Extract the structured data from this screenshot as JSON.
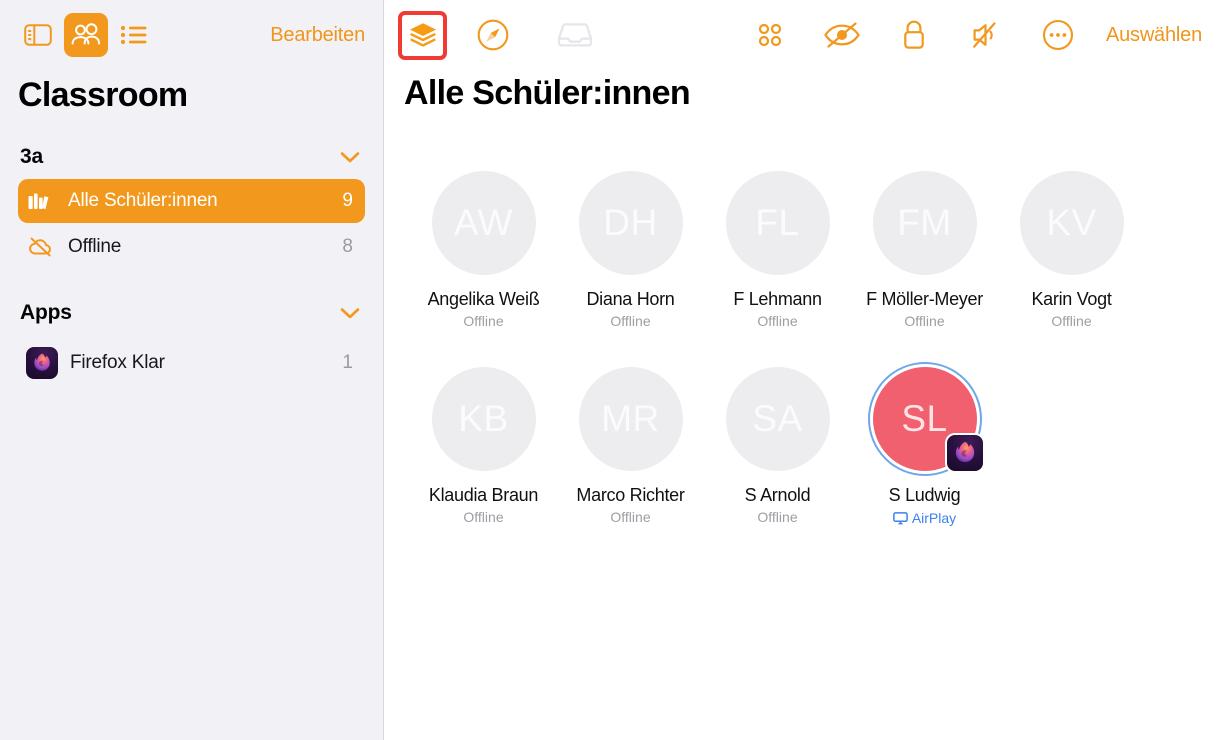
{
  "colors": {
    "accent": "#F2981D",
    "accent_text": "#F0961C",
    "sidebar_bg": "#F2F1F6",
    "highlight_red": "#F03B34",
    "online_avatar": "#F0606E",
    "online_ring": "#6FA8E8",
    "airplay_blue": "#3B82F0",
    "offline_avatar": "#EDEDEF",
    "muted_text": "#9D9DA3"
  },
  "sidebar": {
    "toolbar": {
      "sidebar_toggle_icon": "sidebar-toggle-icon",
      "people_icon": "people-icon",
      "list_icon": "list-icon",
      "edit_label": "Bearbeiten"
    },
    "title": "Classroom",
    "sections": [
      {
        "title": "3a",
        "chevron": "chevron-down-icon",
        "rows": [
          {
            "icon": "books-icon",
            "label": "Alle Schüler:innen",
            "count": "9",
            "selected": true
          },
          {
            "icon": "cloud-slash-icon",
            "label": "Offline",
            "count": "8",
            "selected": false
          }
        ]
      },
      {
        "title": "Apps",
        "chevron": "chevron-down-icon",
        "apps": [
          {
            "icon": "firefox-klar-icon",
            "label": "Firefox Klar",
            "count": "1"
          }
        ]
      }
    ]
  },
  "main": {
    "toolbar": {
      "left": [
        {
          "name": "layers-icon",
          "label": "Layers",
          "highlighted": true,
          "enabled": true
        },
        {
          "name": "compass-icon",
          "label": "Navigate",
          "highlighted": false,
          "enabled": true
        },
        {
          "name": "tray-icon",
          "label": "Inbox",
          "highlighted": false,
          "enabled": false
        }
      ],
      "right": [
        {
          "name": "grid-apps-icon",
          "label": "Apps"
        },
        {
          "name": "eye-slash-icon",
          "label": "Hide screen"
        },
        {
          "name": "lock-icon",
          "label": "Lock"
        },
        {
          "name": "speaker-mute-icon",
          "label": "Mute"
        },
        {
          "name": "ellipsis-circle-icon",
          "label": "More"
        }
      ],
      "select_label": "Auswählen"
    },
    "title": "Alle Schüler:innen",
    "students": [
      {
        "initials": "AW",
        "name": "Angelika Weiß",
        "status": "Offline",
        "online": false,
        "app": null
      },
      {
        "initials": "DH",
        "name": "Diana Horn",
        "status": "Offline",
        "online": false,
        "app": null
      },
      {
        "initials": "FL",
        "name": "F Lehmann",
        "status": "Offline",
        "online": false,
        "app": null
      },
      {
        "initials": "FM",
        "name": "F Möller-Meyer",
        "status": "Offline",
        "online": false,
        "app": null
      },
      {
        "initials": "KV",
        "name": "Karin Vogt",
        "status": "Offline",
        "online": false,
        "app": null
      },
      {
        "initials": "KB",
        "name": "Klaudia Braun",
        "status": "Offline",
        "online": false,
        "app": null
      },
      {
        "initials": "MR",
        "name": "Marco Richter",
        "status": "Offline",
        "online": false,
        "app": null
      },
      {
        "initials": "SA",
        "name": "S Arnold",
        "status": "Offline",
        "online": false,
        "app": null
      },
      {
        "initials": "SL",
        "name": "S Ludwig",
        "status": "AirPlay",
        "online": true,
        "app": "firefox-klar-icon"
      }
    ]
  }
}
